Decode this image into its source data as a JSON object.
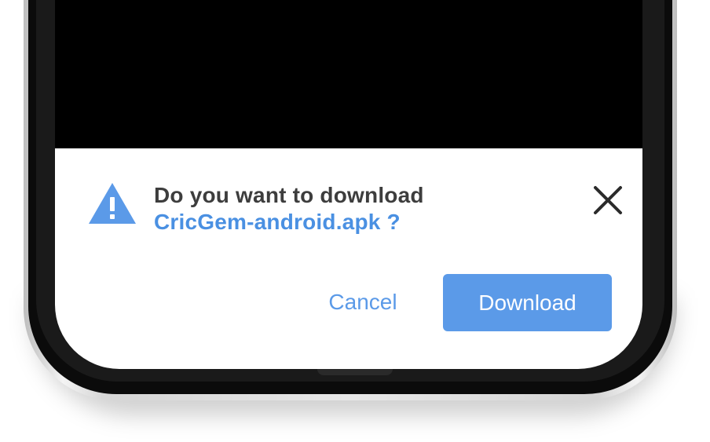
{
  "dialog": {
    "title": "Do you want to download",
    "file_name": "CricGem-android.apk ?",
    "cancel_label": "Cancel",
    "download_label": "Download",
    "icon": "warning-icon",
    "close_icon": "close-icon"
  },
  "colors": {
    "accent": "#5b9ae8",
    "file_text": "#4a90e2",
    "title_text": "#3d3d3d",
    "screen_bg": "#000000",
    "sheet_bg": "#ffffff"
  }
}
